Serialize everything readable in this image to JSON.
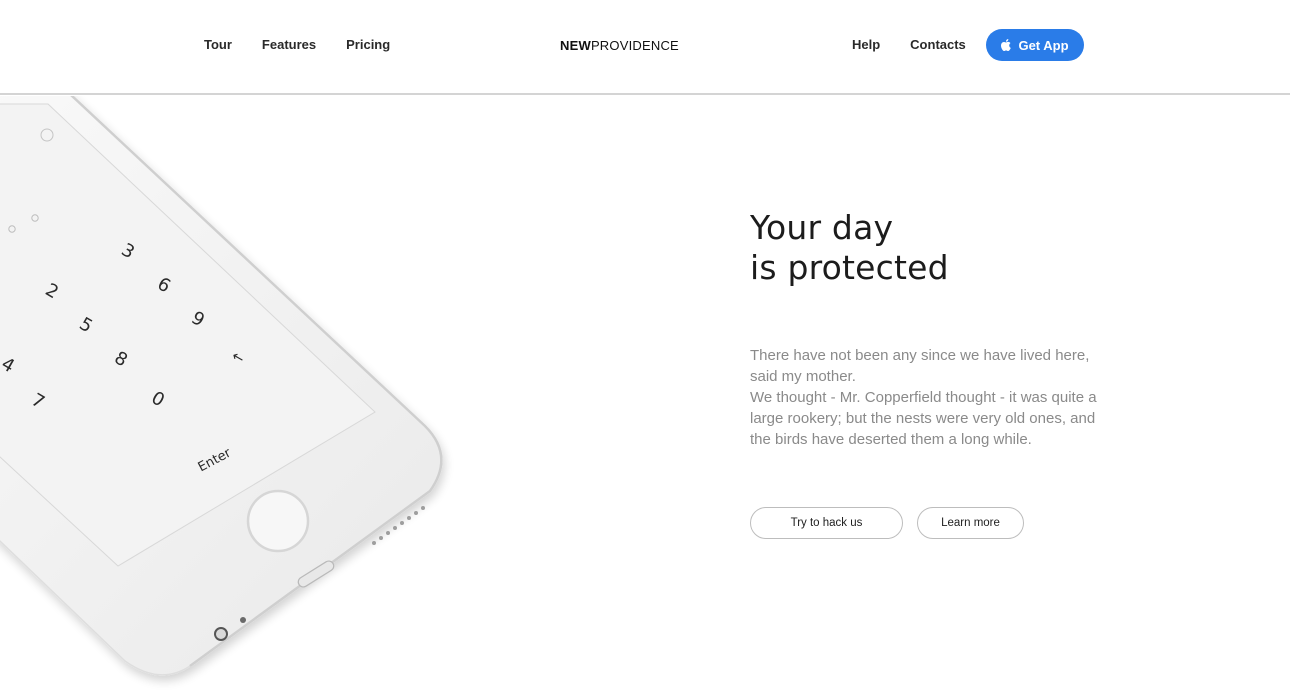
{
  "header": {
    "nav_left": [
      "Tour",
      "Features",
      "Pricing"
    ],
    "brand": {
      "bold": "NEW",
      "regular": "PROVIDENCE"
    },
    "nav_right": [
      "Help",
      "Contacts"
    ],
    "cta_label": "Get App",
    "cta_icon": "apple-icon",
    "accent_color": "#2a7ce8"
  },
  "phone": {
    "keys": [
      "3",
      "2",
      "6",
      "5",
      "9",
      "4",
      "8",
      "7",
      "0"
    ],
    "backspace_glyph": "←",
    "enter_label": "Enter"
  },
  "hero": {
    "title_line1": "Your day",
    "title_line2": "is protected",
    "copy_line1": "There have not been any since we have lived here, said my mother.",
    "copy_line2": "We thought - Mr. Copperfield thought - it was quite a large rookery; but the nests were very old ones, and the birds have deserted them a long while.",
    "button_primary": "Try to hack us",
    "button_secondary": "Learn more"
  }
}
